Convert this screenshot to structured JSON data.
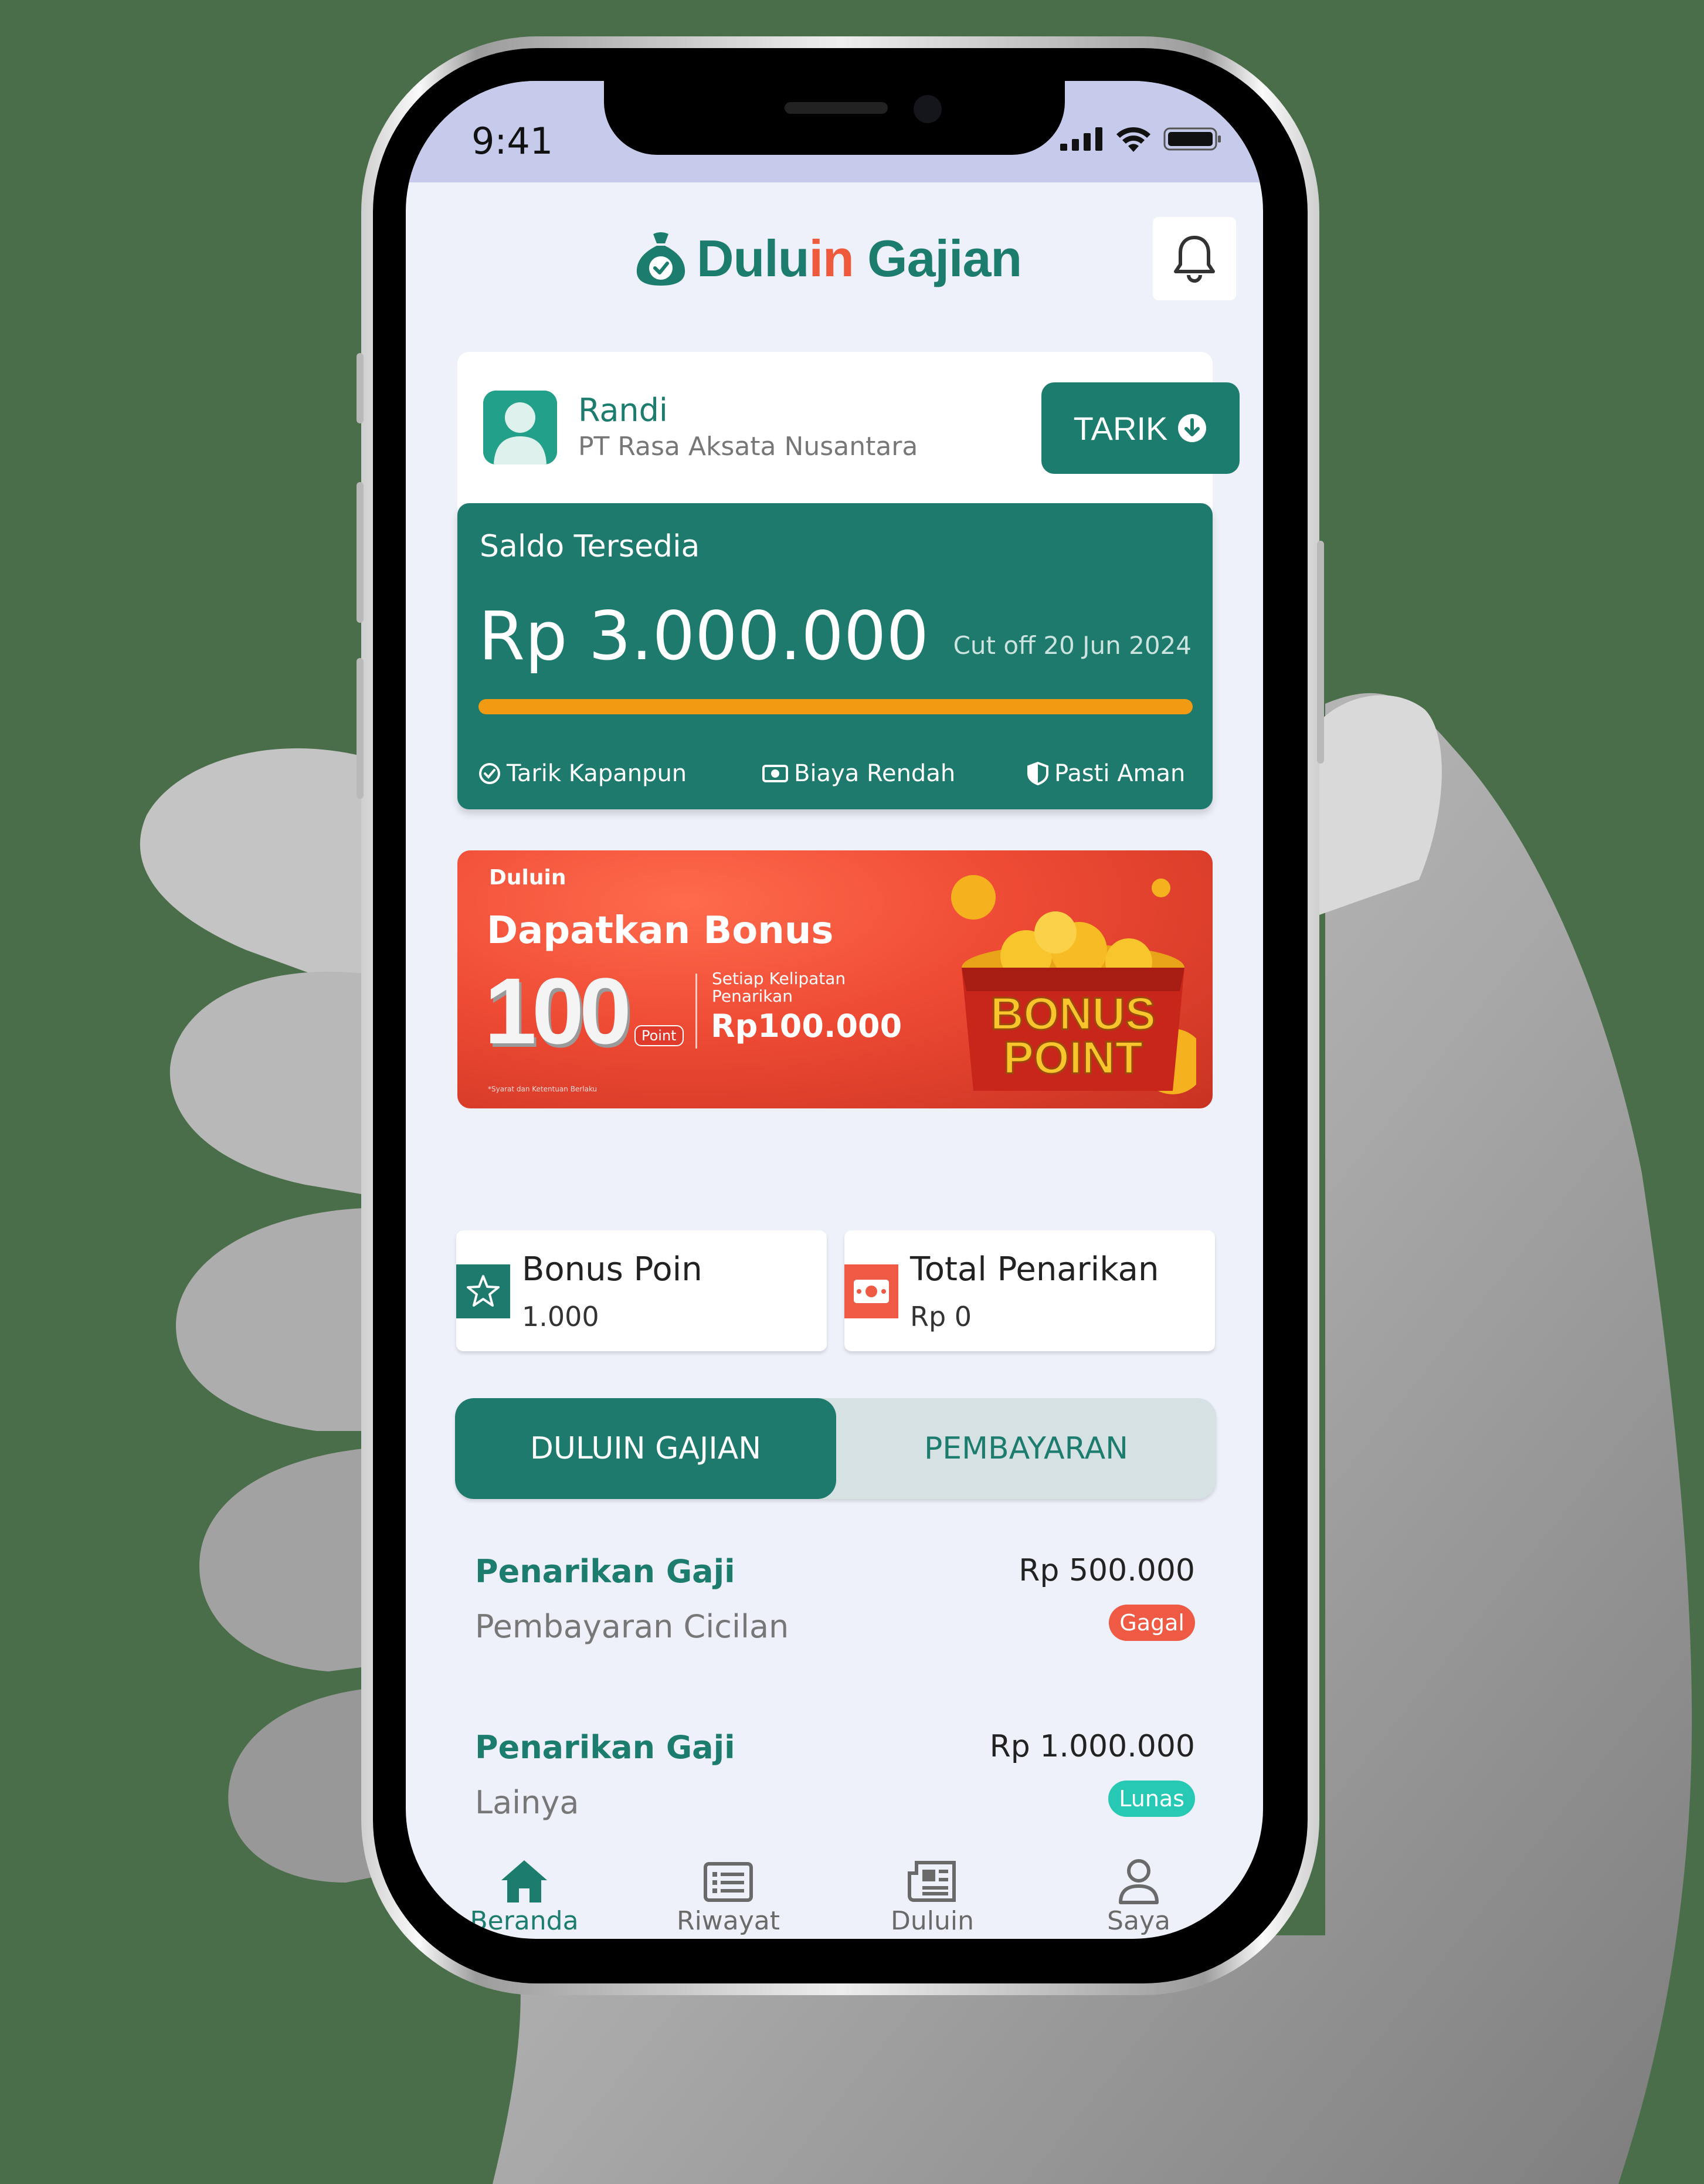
{
  "status_bar": {
    "time": "9:41"
  },
  "header": {
    "logo_part1": "Dulu",
    "logo_part2": "in",
    "logo_part3": " Gajian"
  },
  "profile": {
    "name": "Randi",
    "company": "PT Rasa Aksata Nusantara",
    "withdraw_label": "TARIK"
  },
  "balance": {
    "label": "Saldo Tersedia",
    "amount": "Rp 3.000.000",
    "cutoff": "Cut off 20 Jun 2024",
    "progress_fraction": 1.0,
    "features": [
      "Tarik Kapanpun",
      "Biaya Rendah",
      "Pasti Aman"
    ]
  },
  "banner": {
    "brand": "Duluin",
    "title": "Dapatkan Bonus",
    "big_number": "100",
    "point_tag": "Point",
    "sub_line1": "Setiap Kelipatan",
    "sub_line2": "Penarikan",
    "amount": "Rp100.000",
    "chest_line1": "BONUS",
    "chest_line2": "POINT",
    "fine_print": "*Syarat dan Ketentuan Berlaku"
  },
  "stats": [
    {
      "title": "Bonus Poin",
      "value": "1.000",
      "icon": "star-icon"
    },
    {
      "title": "Total Penarikan",
      "value": "Rp 0",
      "icon": "money-icon"
    }
  ],
  "tabs": [
    {
      "label": "DULUIN GAJIAN",
      "active": true
    },
    {
      "label": "PEMBAYARAN",
      "active": false
    }
  ],
  "transactions": [
    {
      "title": "Penarikan Gaji",
      "subtitle": "Pembayaran Cicilan",
      "amount": "Rp 500.000",
      "status": "Gagal"
    },
    {
      "title": "Penarikan Gaji",
      "subtitle": "Lainya",
      "amount": "Rp 1.000.000",
      "status": "Lunas"
    }
  ],
  "nav": [
    {
      "label": "Beranda",
      "icon": "home-icon",
      "active": true
    },
    {
      "label": "Riwayat",
      "icon": "list-icon",
      "active": false
    },
    {
      "label": "Duluin",
      "icon": "news-icon",
      "active": false
    },
    {
      "label": "Saya",
      "icon": "user-icon",
      "active": false
    }
  ],
  "colors": {
    "primary": "#1c7c6e",
    "accent": "#f05a3c",
    "progress": "#f29a12",
    "status_failed": "#ee5a44",
    "status_paid": "#27c8b4"
  }
}
